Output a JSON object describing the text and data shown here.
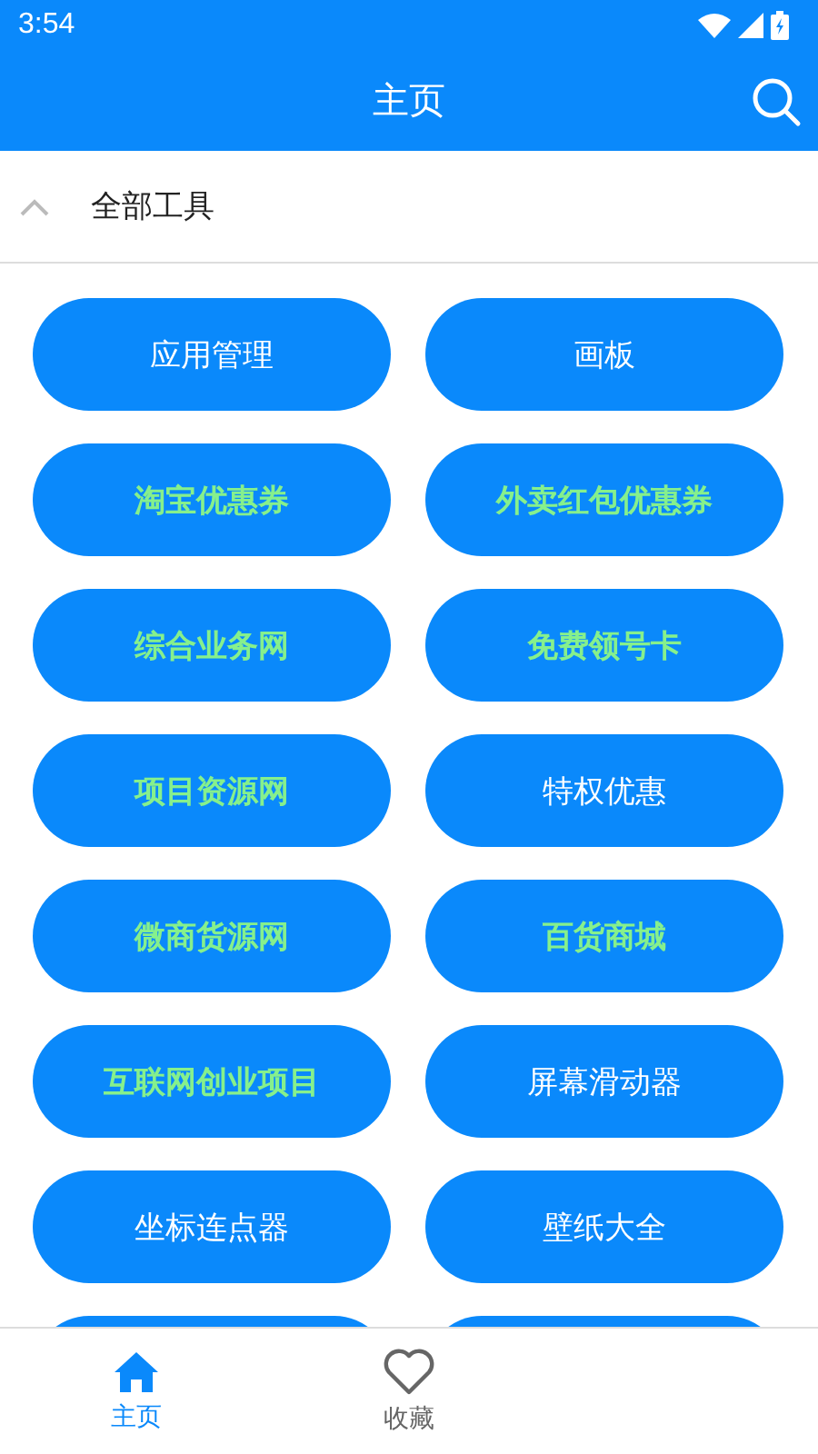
{
  "status_bar": {
    "time": "3:54"
  },
  "app_bar": {
    "title": "主页"
  },
  "section": {
    "title": "全部工具",
    "expanded": true
  },
  "tools": [
    {
      "kind": "tool",
      "label": "应用管理",
      "highlighted": false
    },
    {
      "kind": "tool",
      "label": "画板",
      "highlighted": false
    },
    {
      "kind": "tool",
      "label": "淘宝优惠券",
      "highlighted": true
    },
    {
      "kind": "tool",
      "label": "外卖红包优惠券",
      "highlighted": true
    },
    {
      "kind": "tool",
      "label": "综合业务网",
      "highlighted": true
    },
    {
      "kind": "tool",
      "label": "免费领号卡",
      "highlighted": true
    },
    {
      "kind": "tool",
      "label": "项目资源网",
      "highlighted": true
    },
    {
      "kind": "tool",
      "label": "特权优惠",
      "highlighted": false
    },
    {
      "kind": "tool",
      "label": "微商货源网",
      "highlighted": true
    },
    {
      "kind": "tool",
      "label": "百货商城",
      "highlighted": true
    },
    {
      "kind": "tool",
      "label": "互联网创业项目",
      "highlighted": true
    },
    {
      "kind": "tool",
      "label": "屏幕滑动器",
      "highlighted": false
    },
    {
      "kind": "tool",
      "label": "坐标连点器",
      "highlighted": false
    },
    {
      "kind": "tool",
      "label": "壁纸大全",
      "highlighted": false
    },
    {
      "kind": "cut"
    },
    {
      "kind": "cut"
    }
  ],
  "bottom_nav": [
    {
      "label": "主页",
      "selected": true
    },
    {
      "label": "收藏",
      "selected": false
    }
  ]
}
